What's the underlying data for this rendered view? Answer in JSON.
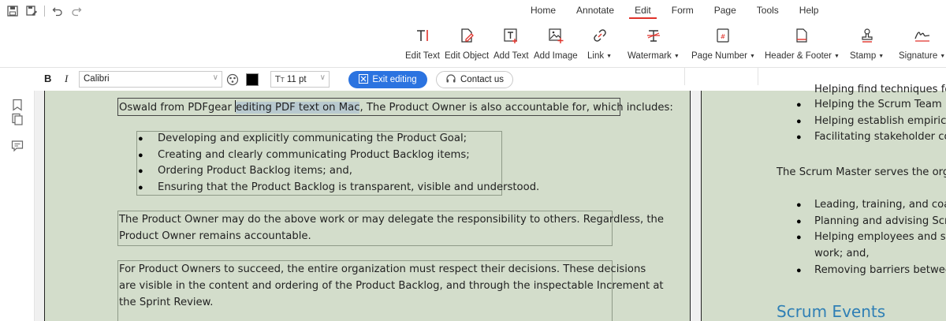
{
  "quick_access": {
    "icons": [
      "save-icon",
      "save-as-icon",
      "undo-icon",
      "redo-icon"
    ]
  },
  "menu": {
    "tabs": [
      "Home",
      "Annotate",
      "Edit",
      "Form",
      "Page",
      "Tools",
      "Help"
    ],
    "active": "Edit"
  },
  "ribbon": {
    "edit_text": "Edit Text",
    "edit_object": "Edit Object",
    "add_text": "Add Text",
    "add_image": "Add Image",
    "link": "Link",
    "watermark": "Watermark",
    "page_number": "Page Number",
    "header_footer": "Header & Footer",
    "stamp": "Stamp",
    "signature": "Signature"
  },
  "format_bar": {
    "bold": "B",
    "italic": "I",
    "font": "Calibri",
    "font_size": "11 pt",
    "text_color": "#000000",
    "exit_editing": "Exit editing",
    "contact_us": "Contact us"
  },
  "page1": {
    "line1_a": "Oswald from PDFgear ",
    "line1_hl": "editing PDF text on Mac",
    "line1_b": ", The Product Owner is also accountable for, which includes:",
    "list": [
      "Developing and explicitly communicating the Product Goal;",
      "Creating and clearly communicating Product Backlog items;",
      "Ordering Product Backlog items; and,",
      "Ensuring that the Product Backlog is transparent, visible and understood."
    ],
    "para1": [
      "The Product Owner may do the above work or may delegate the responsibility to others. Regardless, the",
      "Product Owner remains accountable."
    ],
    "para2": [
      "For Product Owners to succeed, the entire organization must respect their decisions. These decisions",
      "are visible in the content and ordering of the Product Backlog, and through the inspectable Increment at",
      "the Sprint Review."
    ]
  },
  "page2": {
    "cut_line": "Helping find techniques for",
    "list1": [
      "Helping the Scrum Team und",
      "Helping establish empirical p",
      "Facilitating stakeholder colla"
    ],
    "para": "The Scrum Master serves the organi",
    "list2": [
      "Leading, training, and coach",
      "Planning and advising Scrum",
      "Helping employees and stak",
      "work; and,",
      "Removing barriers between"
    ],
    "heading": "Scrum Events"
  },
  "colors": {
    "accent": "#2b73e0",
    "active_tab": "#e0322a",
    "page_bg": "#d3ddcb",
    "heading": "#2f7fb5"
  }
}
